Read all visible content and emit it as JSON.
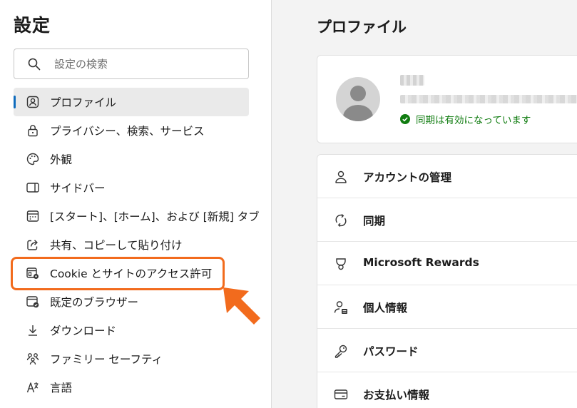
{
  "sidebar": {
    "title": "設定",
    "search_placeholder": "設定の検索",
    "items": [
      {
        "label": "プロファイル",
        "icon": "profile-icon",
        "selected": true
      },
      {
        "label": "プライバシー、検索、サービス",
        "icon": "lock-icon"
      },
      {
        "label": "外観",
        "icon": "palette-icon"
      },
      {
        "label": "サイドバー",
        "icon": "sidebar-icon"
      },
      {
        "label": "[スタート]、[ホーム]、および [新規] タブ",
        "icon": "home-tabs-icon"
      },
      {
        "label": "共有、コピーして貼り付け",
        "icon": "share-icon"
      },
      {
        "label": "Cookie とサイトのアクセス許可",
        "icon": "cookie-settings-icon",
        "highlighted": true
      },
      {
        "label": "既定のブラウザー",
        "icon": "default-browser-icon"
      },
      {
        "label": "ダウンロード",
        "icon": "download-icon"
      },
      {
        "label": "ファミリー セーフティ",
        "icon": "family-icon"
      },
      {
        "label": "言語",
        "icon": "language-icon"
      }
    ]
  },
  "main": {
    "title": "プロファイル",
    "profile": {
      "sync_status": "同期は有効になっています"
    },
    "menu": [
      {
        "label": "アカウントの管理",
        "icon": "account-icon"
      },
      {
        "label": "同期",
        "icon": "sync-icon"
      },
      {
        "label": "Microsoft Rewards",
        "icon": "rewards-icon"
      },
      {
        "label": "個人情報",
        "icon": "personal-info-icon"
      },
      {
        "label": "パスワード",
        "icon": "key-icon"
      },
      {
        "label": "お支払い情報",
        "icon": "card-icon"
      }
    ]
  },
  "colors": {
    "accent": "#0f6cbd",
    "highlight": "#f26b1d",
    "success": "#107c10"
  }
}
